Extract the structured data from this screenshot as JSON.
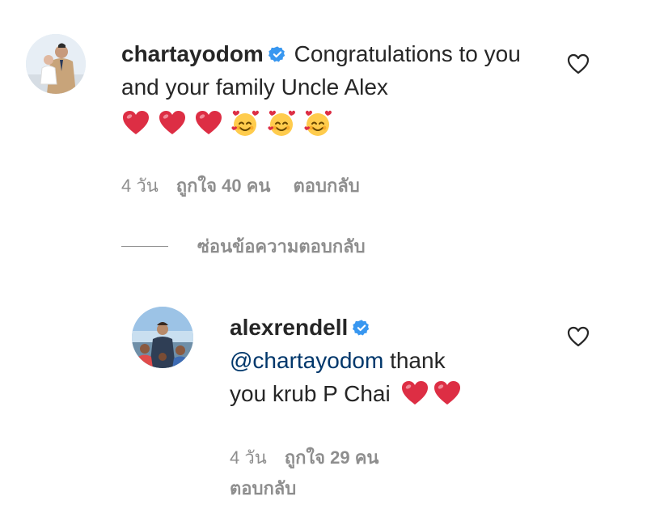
{
  "comment": {
    "username": "chartayodom",
    "verified_icon": "verified-badge-icon",
    "text": "Congratulations to you and your family Uncle Alex",
    "emojis": [
      "red-heart",
      "red-heart",
      "red-heart",
      "smiling-face-with-hearts",
      "smiling-face-with-hearts",
      "smiling-face-with-hearts"
    ],
    "time": "4 วัน",
    "likes": "ถูกใจ 40 คน",
    "reply_label": "ตอบกลับ"
  },
  "hide_replies_label": "ซ่อนข้อความตอบกลับ",
  "reply": {
    "username": "alexrendell",
    "verified_icon": "verified-badge-icon",
    "mention": "@chartayodom",
    "text_line1": " thank",
    "text_line2": "you krub P Chai",
    "emojis": [
      "red-heart",
      "red-heart"
    ],
    "time": "4 วัน",
    "likes": "ถูกใจ 29 คน",
    "reply_label": "ตอบกลับ"
  },
  "colors": {
    "text": "#262626",
    "meta": "#8e8e8e",
    "mention": "#00376b",
    "verified": "#3897f0"
  }
}
